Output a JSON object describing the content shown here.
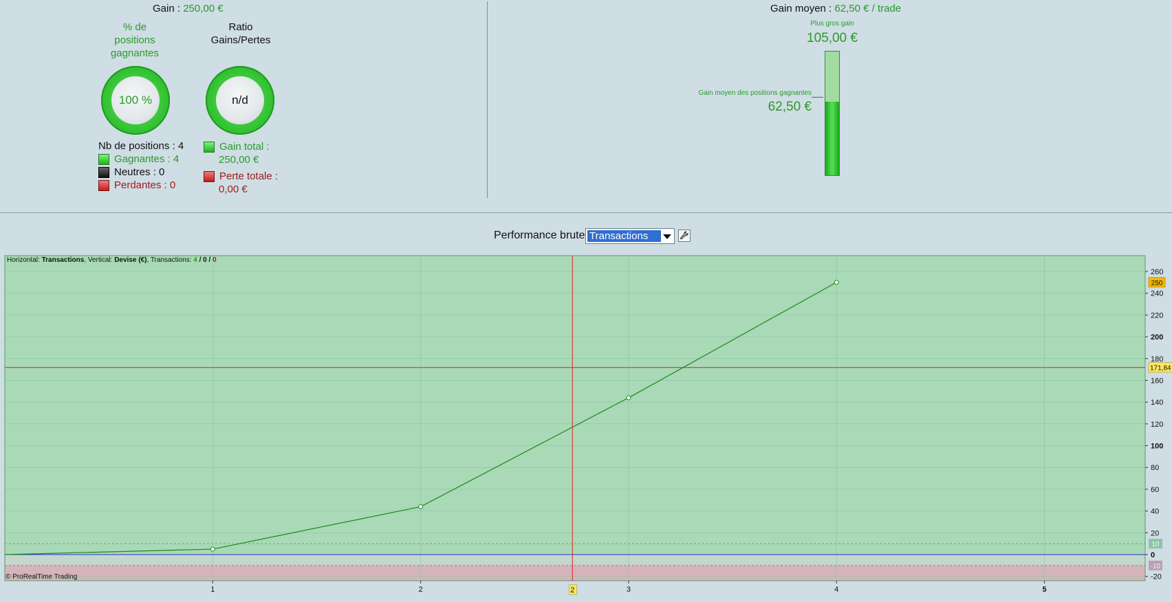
{
  "summary": {
    "gain_label": "Gain : ",
    "gain_value": "250,00 €",
    "pct_title_line1": "% de",
    "pct_title_line2": "positions",
    "pct_title_line3": "gagnantes",
    "pct_value": "100 %",
    "ratio_title_line1": "Ratio",
    "ratio_title_line2": "Gains/Pertes",
    "ratio_value": "n/d",
    "positions_count": "Nb de positions : 4",
    "gagnantes": "Gagnantes : 4",
    "neutres": "Neutres : 0",
    "perdantes": "Perdantes : 0",
    "gain_total_label": "Gain total :",
    "gain_total_value": "250,00 €",
    "perte_totale_label": "Perte totale :",
    "perte_totale_value": "0,00 €"
  },
  "gain_moyen": {
    "label": "Gain moyen : ",
    "value": "62,50 € / trade",
    "max_gain_label": "Plus gros gain",
    "max_gain_value": "105,00 €",
    "avg_win_label": "Gain moyen des positions gagnantes",
    "avg_win_value": "62,50 €",
    "gauge_fraction": 0.595
  },
  "performance": {
    "label": "Performance brute",
    "select_value": "Transactions",
    "settings_icon": "wrench-icon"
  },
  "chart_info": {
    "horizontal_label": "Horizontal: ",
    "horizontal_value": "Transactions",
    "vertical_label": ", Vertical: ",
    "vertical_value": "Devise (€)",
    "transactions_label": ", Transactions: ",
    "tx_win": "4",
    "tx_sep1": " / ",
    "tx_neutral": "0",
    "tx_sep2": " / ",
    "tx_loss": "0",
    "copyright": "© ProRealTime Trading"
  },
  "colors": {
    "positive_zone": "#a9d9b6",
    "negative_zone": "#d6b4bc",
    "line": "#1a8a1a",
    "crosshair": "#e02020",
    "zero_line": "#2233cc",
    "price_tag": "#ffe95a"
  },
  "chart_data": {
    "type": "line",
    "x": [
      0,
      1,
      2,
      3,
      4
    ],
    "values": [
      0,
      5,
      44,
      144,
      250
    ],
    "xlim": [
      0,
      5.5
    ],
    "ylim": [
      -24,
      272
    ],
    "x_ticks": [
      "1",
      "2",
      "3",
      "4",
      "5"
    ],
    "y_ticks": [
      260,
      240,
      220,
      200,
      180,
      160,
      140,
      120,
      100,
      80,
      60,
      40,
      20,
      0,
      -20
    ],
    "y_tick_labels": [
      "260",
      "240",
      "220",
      "200",
      "180",
      "160",
      "140",
      "120",
      "100",
      "80",
      "60",
      "40",
      "20",
      "0",
      "-20"
    ],
    "last_value_tag": "250",
    "crosshair_y_value": 171.84,
    "crosshair_y_tag": "171,84",
    "crosshair_x_value": 2.73,
    "crosshair_x_tag": "2",
    "upper_band": 10,
    "lower_band": -10,
    "upper_band_tag": "10",
    "lower_band_tag": "-10"
  }
}
